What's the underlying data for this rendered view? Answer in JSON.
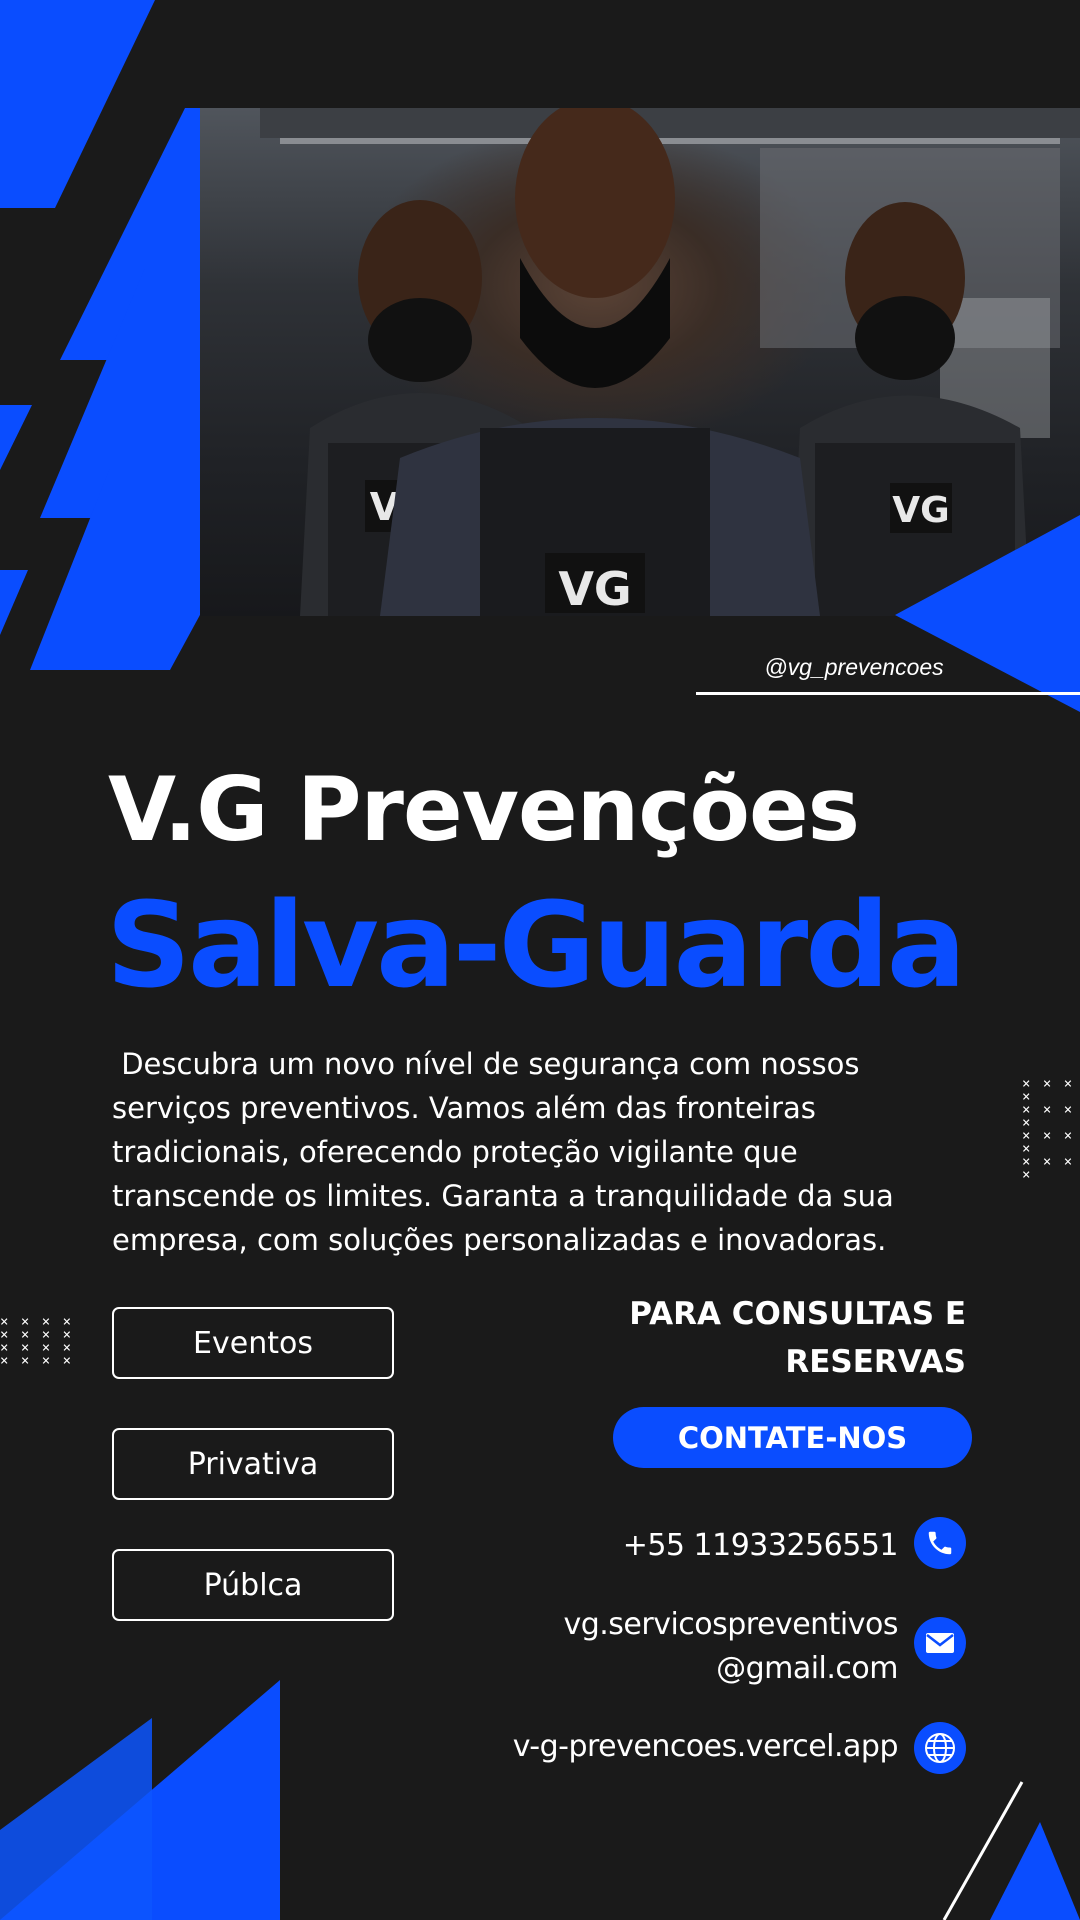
{
  "social": {
    "handle": "@vg_prevencoes"
  },
  "brand": {
    "title": "V.G Prevenções",
    "subtitle": "Salva-Guarda",
    "description": " Descubra um novo nível de segurança com nossos\nserviços preventivos. Vamos além das fronteiras\ntradicionais, oferecendo proteção vigilante que\ntranscende os limites. Garanta a tranquilidade da sua\nempresa, com soluções personalizadas e inovadoras."
  },
  "photo": {
    "vest_label": "VG"
  },
  "services": [
    {
      "label": "Eventos"
    },
    {
      "label": "Privativa"
    },
    {
      "label": "Públca"
    }
  ],
  "contact": {
    "heading_line1": "PARA CONSULTAS E",
    "heading_line2": "RESERVAS",
    "cta_label": "CONTATE-NOS",
    "phone": "+55 11933256551",
    "email_line1": "vg.servicospreventivos",
    "email_line2": "@gmail.com",
    "website": "v-g-prevencoes.vercel.app",
    "icons": [
      "phone-icon",
      "email-icon",
      "globe-icon"
    ]
  },
  "colors": {
    "accent": "#0a4dff",
    "background": "#1a1a1a",
    "text": "#ffffff"
  }
}
